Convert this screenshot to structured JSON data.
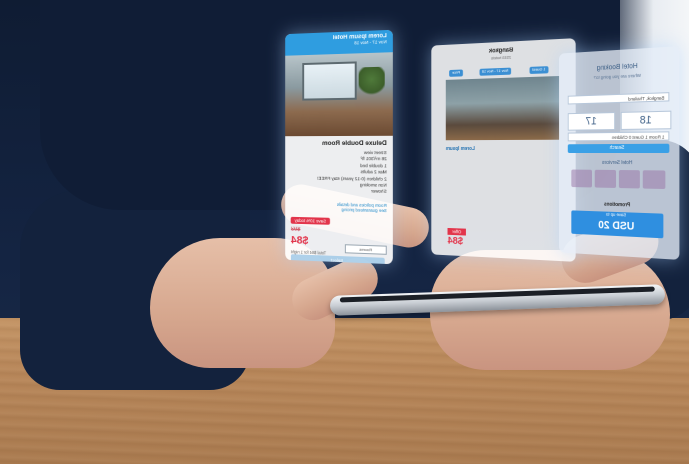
{
  "hotel_card": {
    "hotel_name": "Lorem Ipsum Hotel",
    "dates": "Nov 17 - Nov 18",
    "room_title": "Deluxe Double Room",
    "amenities": [
      "Street view",
      "28 m²/301 ft²",
      "1 double bed",
      "Max 2 adults",
      "2 children (0-12 years) stay FREE!",
      "Non smoking",
      "Shower"
    ],
    "link_text": "Room policies and details",
    "link_text_2": "See guaranteed pricing",
    "offer_badge": "Save 10% today",
    "price_old": "$93",
    "price_new": "$84",
    "price_note": "Total $84 for 1 night",
    "quantity_label": "Rooms",
    "select_label": "Select"
  },
  "middle_card": {
    "city": "Bangkok",
    "subtitle": "2533 hotels",
    "chip_1": "Price",
    "chip_2": "Nov 17 - Nov 18",
    "chip_3": "1 Guest",
    "listing_title": "Lorem Ipsum",
    "badge": "Offer",
    "price": "$84"
  },
  "booking_card": {
    "title": "Hotel Booking",
    "subtitle": "Where are you going to?",
    "destination": "Bangkok, Thailand",
    "checkin_day": "17",
    "checkout_day": "18",
    "guests": "1 Room 1 Guest 0 Children",
    "search_label": "Search",
    "section_label": "Hotel Services",
    "promo_label": "Promotions",
    "promo_subtitle": "Save up to",
    "promo_amount": "USD 20"
  }
}
